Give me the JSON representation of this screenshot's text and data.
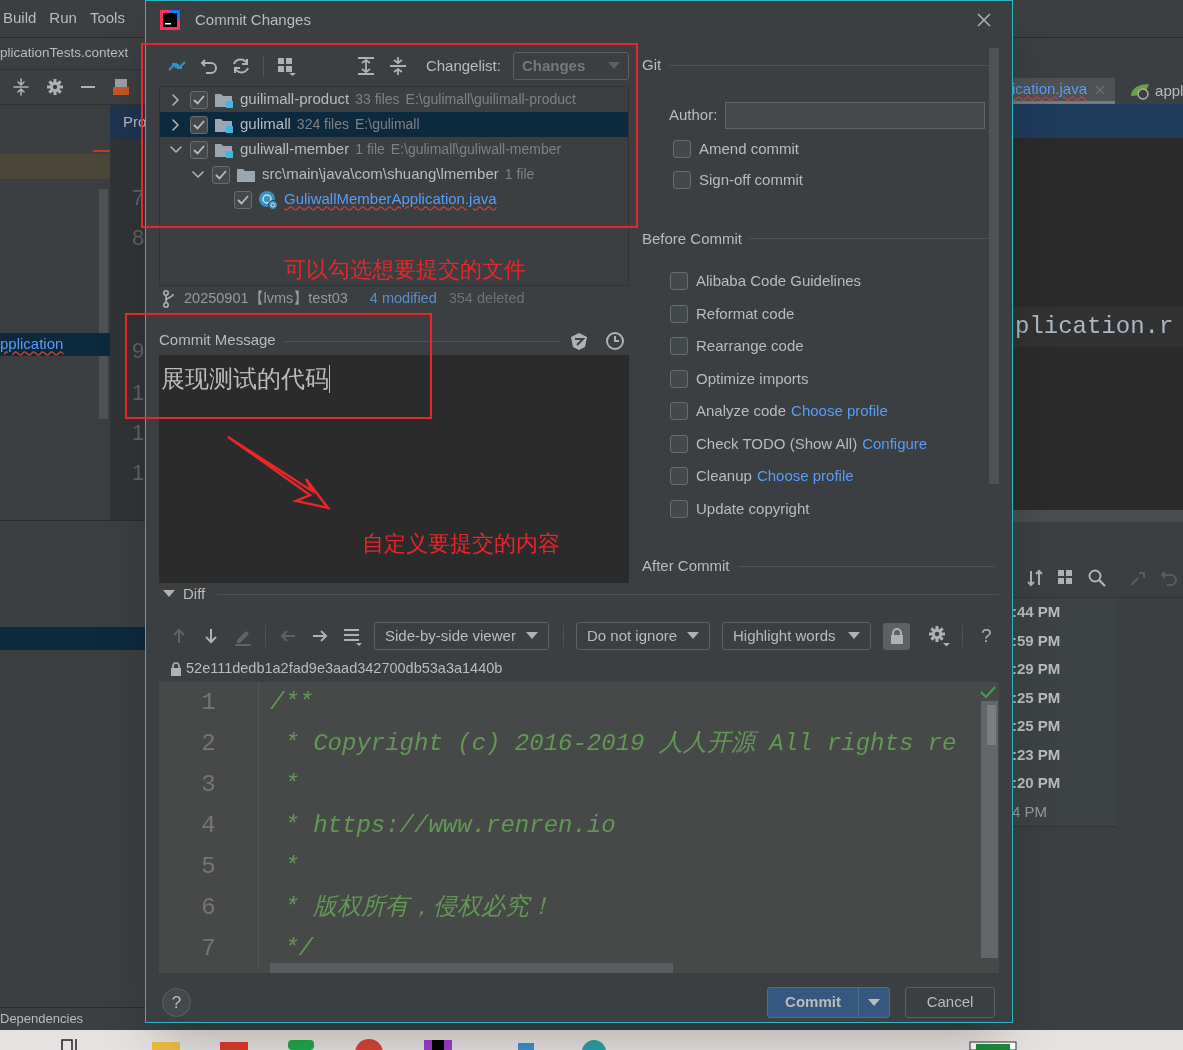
{
  "ide": {
    "menu": [
      {
        "label": "Build"
      },
      {
        "label": "Run"
      },
      {
        "label": "Tools"
      }
    ],
    "left_tab": "plicationTests.context",
    "project_tab": "Pro",
    "project_item": "pplication",
    "gutter_lines": [
      "7",
      "8",
      "9",
      "1",
      "1",
      "1"
    ],
    "editor_tabs": [
      {
        "label": "ication.java",
        "closable": true
      },
      {
        "label": "appl",
        "closable": false
      }
    ],
    "code_fragment": "plication.r",
    "log_times": [
      {
        "text": ":44 PM",
        "bold": true
      },
      {
        "text": ":59 PM",
        "bold": true
      },
      {
        "text": ":29 PM",
        "bold": true
      },
      {
        "text": ":25 PM",
        "bold": true
      },
      {
        "text": ":25 PM",
        "bold": true
      },
      {
        "text": ":23 PM",
        "bold": true
      },
      {
        "text": ":20 PM",
        "bold": true
      },
      {
        "text": "4 PM",
        "bold": false
      }
    ],
    "bottom_tool": "Dependencies"
  },
  "dialog": {
    "title": "Commit Changes",
    "changelist": {
      "label": "Changelist:",
      "value": "Changes"
    },
    "tree": [
      {
        "kind": "module",
        "name": "guilimall-product",
        "count": "33 files",
        "path": "E:\\gulimall\\guilimall-product",
        "checked": true,
        "expanded": false,
        "selected": false
      },
      {
        "kind": "module",
        "name": "gulimall",
        "count": "324 files",
        "path": "E:\\gulimall",
        "checked": true,
        "expanded": false,
        "selected": true
      },
      {
        "kind": "module",
        "name": "guliwall-member",
        "count": "1 file",
        "path": "E:\\gulimall\\guliwall-member",
        "checked": true,
        "expanded": true,
        "selected": false,
        "children": [
          {
            "kind": "folder",
            "name": "src\\main\\java\\com\\shuang\\lmember",
            "count": "1 file",
            "checked": true,
            "expanded": true,
            "selected": false,
            "children": [
              {
                "kind": "file",
                "name": "GuliwallMemberApplication.java",
                "checked": true,
                "selected": false
              }
            ]
          }
        ]
      }
    ],
    "status": {
      "branch": "20250901【lvms】test03",
      "modified": "4 modified",
      "deleted": "354 deleted"
    },
    "commit_message": {
      "label": "Commit Message",
      "value": "展现测试的代码"
    },
    "git": {
      "header": "Git",
      "author_label": "Author:",
      "options": [
        {
          "label": "Amend commit",
          "checked": false
        },
        {
          "label": "Sign-off commit",
          "checked": false
        }
      ]
    },
    "before_commit": {
      "header": "Before Commit",
      "options": [
        {
          "label": "Alibaba Code Guidelines",
          "checked": false
        },
        {
          "label": "Reformat code",
          "checked": false
        },
        {
          "label": "Rearrange code",
          "checked": false
        },
        {
          "label": "Optimize imports",
          "checked": false
        },
        {
          "label": "Analyze code",
          "link": "Choose profile",
          "checked": false
        },
        {
          "label": "Check TODO (Show All)",
          "link": "Configure",
          "checked": false
        },
        {
          "label": "Cleanup",
          "link": "Choose profile",
          "checked": false
        },
        {
          "label": "Update copyright",
          "checked": false
        }
      ]
    },
    "after_commit": {
      "header": "After Commit"
    },
    "diff": {
      "header": "Diff",
      "expanded": true,
      "viewer": "Side-by-side viewer",
      "ignore": "Do not ignore",
      "highlight": "Highlight words",
      "lock_on": true,
      "help": "?",
      "hash": "52e111dedb1a2fad9e3aad342700db53a3a1440b",
      "lines": [
        {
          "number": "1",
          "text": "/**"
        },
        {
          "number": "2",
          "text": " * Copyright (c) 2016-2019 人人开源 All rights re"
        },
        {
          "number": "3",
          "text": " *"
        },
        {
          "number": "4",
          "text": " * https://www.renren.io"
        },
        {
          "number": "5",
          "text": " *"
        },
        {
          "number": "6",
          "text": " * 版权所有，侵权必究！"
        },
        {
          "number": "7",
          "text": " */"
        }
      ]
    },
    "buttons": {
      "help": "?",
      "commit": "Commit",
      "cancel": "Cancel"
    },
    "annotations": [
      {
        "text": "可以勾选想要提交的文件"
      },
      {
        "text": "自定义要提交的内容"
      }
    ]
  }
}
